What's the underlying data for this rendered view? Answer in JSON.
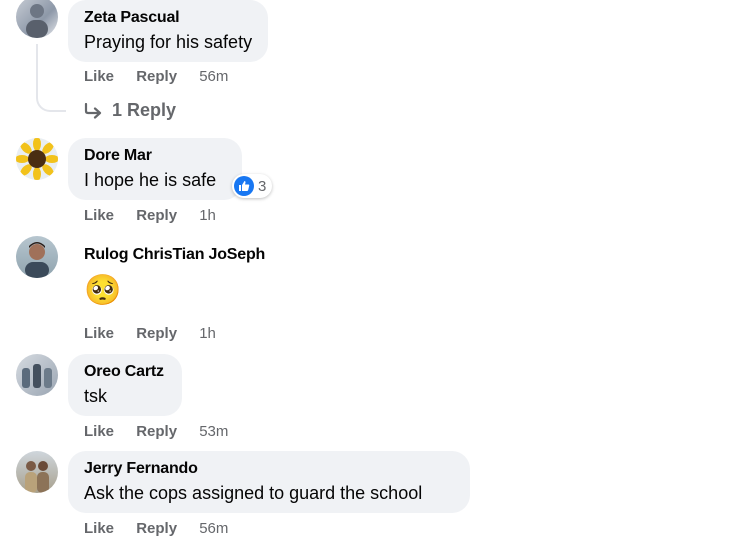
{
  "comments": [
    {
      "author": "Zeta Pascual",
      "text": "Praying for his safety",
      "actions": {
        "like": "Like",
        "reply": "Reply",
        "time": "56m"
      },
      "replies_label": "1 Reply"
    },
    {
      "author": "Dore Mar",
      "text": "I hope he is safe",
      "actions": {
        "like": "Like",
        "reply": "Reply",
        "time": "1h"
      },
      "reaction_count": "3"
    },
    {
      "author": "Rulog ChrisTian JoSeph",
      "text": "🥺",
      "actions": {
        "like": "Like",
        "reply": "Reply",
        "time": "1h"
      }
    },
    {
      "author": "Oreo Cartz",
      "text": "tsk",
      "actions": {
        "like": "Like",
        "reply": "Reply",
        "time": "53m"
      }
    },
    {
      "author": "Jerry Fernando",
      "text": "Ask the cops assigned to guard the school",
      "actions": {
        "like": "Like",
        "reply": "Reply",
        "time": "56m"
      }
    }
  ],
  "colors": {
    "bubble": "#f0f2f5",
    "meta_text": "#65676b",
    "like_blue": "#1877f2"
  },
  "icons": [
    "reply-arrow-icon",
    "like-reaction-icon"
  ]
}
